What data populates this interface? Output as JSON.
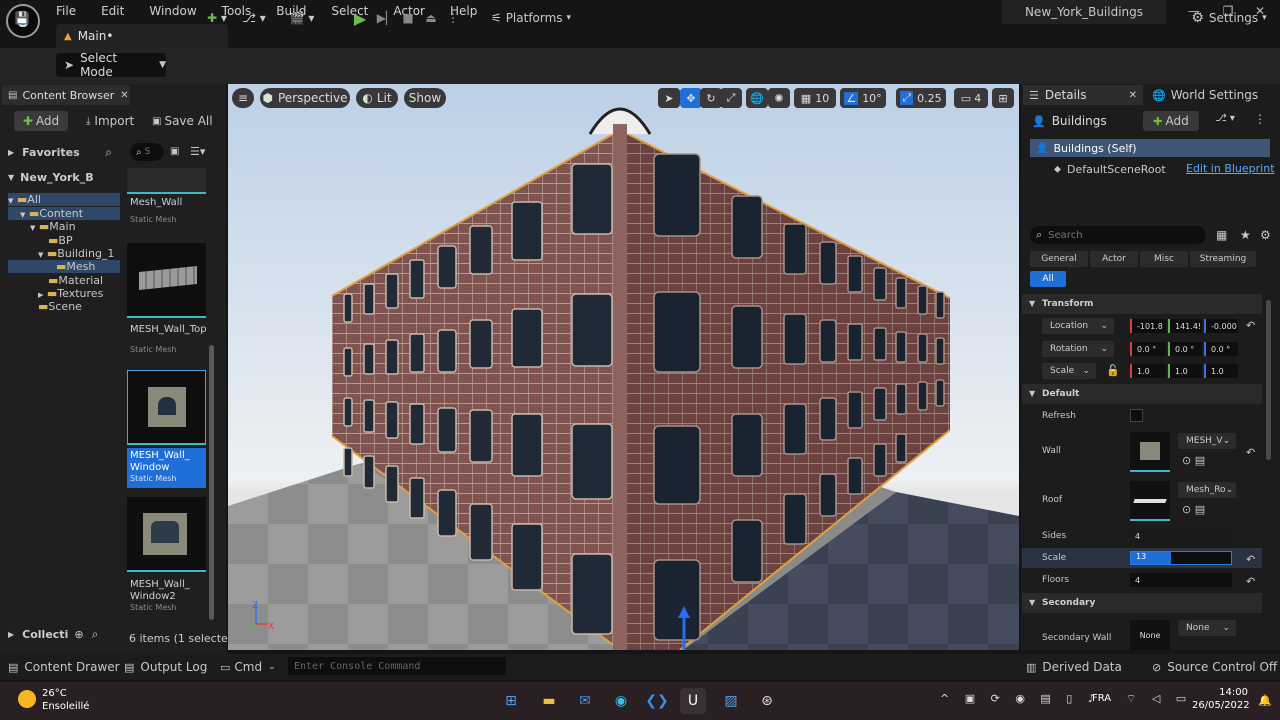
{
  "menu": [
    "File",
    "Edit",
    "Window",
    "Tools",
    "Build",
    "Select",
    "Actor",
    "Help"
  ],
  "main_tab": "Main•",
  "project_title": "New_York_Buildings",
  "toolbar": {
    "select_mode": "Select Mode",
    "platforms": "Platforms",
    "settings": "Settings"
  },
  "content_browser": {
    "tab": "Content Browser",
    "add": "Add",
    "import": "Import",
    "save_all": "Save All",
    "favorites": "Favorites",
    "project_root": "New_York_B",
    "search_placeholder": "S",
    "tree": [
      "All",
      "Content",
      "Main",
      "BP",
      "Building_1",
      "Mesh",
      "Material",
      "Textures",
      "Scene"
    ],
    "assets": [
      {
        "name": "Mesh_Wall",
        "type": "Static Mesh"
      },
      {
        "name": "MESH_Wall_Top",
        "type": "Static Mesh"
      },
      {
        "name": "MESH_Wall_ Window",
        "type": "Static Mesh"
      },
      {
        "name": "MESH_Wall_ Window2",
        "type": "Static Mesh"
      }
    ],
    "collections": "Collecti",
    "items_count": "6 items (1 selecte"
  },
  "viewport": {
    "perspective": "Perspective",
    "lit": "Lit",
    "show": "Show",
    "grid_snap": "10",
    "rot_snap": "10°",
    "scale_snap": "0.25",
    "cam_speed": "4"
  },
  "details": {
    "tab": "Details",
    "world_settings": "World Settings",
    "actor": "Buildings",
    "add": "Add",
    "self_item": "Buildings (Self)",
    "root": "DefaultSceneRoot",
    "edit_bp": "Edit in Blueprint",
    "search_placeholder": "Search",
    "filters": [
      "General",
      "Actor",
      "Misc",
      "Streaming",
      "All"
    ],
    "transform": "Transform",
    "location_label": "Location",
    "location": [
      "-101.8",
      "141.4!",
      "-0.000"
    ],
    "rotation_label": "Rotation",
    "rotation": [
      "0.0 °",
      "0.0 °",
      "0.0 °"
    ],
    "scale_label": "Scale",
    "scale": [
      "1.0",
      "1.0",
      "1.0"
    ],
    "default": "Default",
    "refresh": "Refresh",
    "wall": "Wall",
    "wall_mesh": "MESH_V",
    "roof": "Roof",
    "roof_mesh": "Mesh_Ro",
    "sides": "Sides",
    "sides_value": "4",
    "scale2": "Scale",
    "scale2_value": "13",
    "scale2_fill": 0.4,
    "floors": "Floors",
    "floors_value": "4",
    "secondary": "Secondary",
    "secondary_wall": "Secondary Wall",
    "secondary_none": "None",
    "secondary_drop": "None"
  },
  "bottom": {
    "content_drawer": "Content Drawer",
    "output_log": "Output Log",
    "cmd": "Cmd",
    "console_placeholder": "Enter Console Command",
    "derived_data": "Derived Data",
    "source_control": "Source Control Off"
  },
  "taskbar": {
    "temp": "26°C",
    "weather": "Ensoleillé",
    "lang": "FRA",
    "time": "14:00",
    "date": "26/05/2022"
  }
}
